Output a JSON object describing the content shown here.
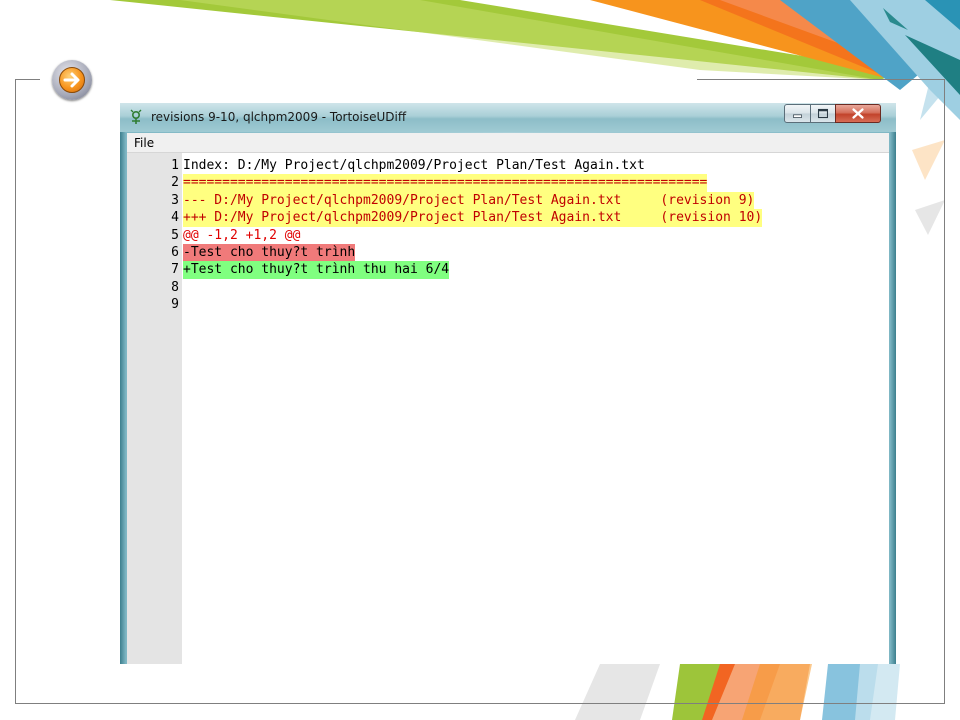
{
  "window": {
    "title": "revisions 9-10, qlchpm2009 - TortoiseUDiff",
    "app_icon": "tortoise-icon",
    "buttons": [
      "minimize-icon",
      "maximize-icon",
      "close-icon"
    ]
  },
  "menu": {
    "file": "File"
  },
  "diff": {
    "lines": [
      {
        "n": "1",
        "text": "Index: D:/My Project/qlchpm2009/Project Plan/Test Again.txt",
        "kind": "plain",
        "color": "#000000"
      },
      {
        "n": "2",
        "text": "===================================================================",
        "kind": "sep",
        "color": "#c00000"
      },
      {
        "n": "3",
        "text": "--- D:/My Project/qlchpm2009/Project Plan/Test Again.txt     (revision 9)",
        "kind": "header",
        "color": "#c00000"
      },
      {
        "n": "4",
        "text": "+++ D:/My Project/qlchpm2009/Project Plan/Test Again.txt     (revision 10)",
        "kind": "header",
        "color": "#c00000"
      },
      {
        "n": "5",
        "text": "@@ -1,2 +1,2 @@",
        "kind": "hunk",
        "color": "#e00000"
      },
      {
        "n": "6",
        "text": "-Test cho thuy?t trình",
        "kind": "del",
        "color": "#000000"
      },
      {
        "n": "7",
        "text": "+Test cho thuy?t trình thu hai 6/4",
        "kind": "add",
        "color": "#000000"
      },
      {
        "n": "8",
        "text": "",
        "kind": "plain",
        "color": "#000000"
      },
      {
        "n": "9",
        "text": "",
        "kind": "plain",
        "color": "#000000"
      }
    ]
  },
  "slide": {
    "nav_icon": "arrow-right-icon"
  }
}
